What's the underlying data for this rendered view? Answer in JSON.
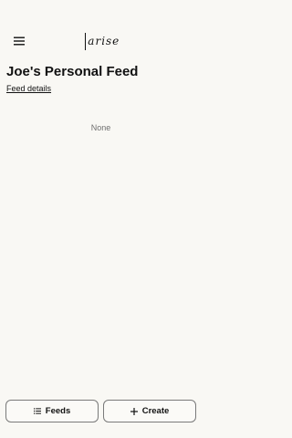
{
  "header": {
    "logo_text": "arise",
    "menu_icon": "hamburger-menu-icon"
  },
  "feed": {
    "title": "Joe's Personal Feed",
    "details_link": "Feed details",
    "empty_text": "None"
  },
  "bottom_bar": {
    "feeds_label": "Feeds",
    "feeds_icon": "list-icon",
    "create_label": "Create",
    "create_icon": "plus-icon"
  },
  "colors": {
    "background": "#f9f8f4",
    "text": "#111111",
    "muted_text": "#6f6f6f",
    "button_border": "#7a7a7a"
  }
}
